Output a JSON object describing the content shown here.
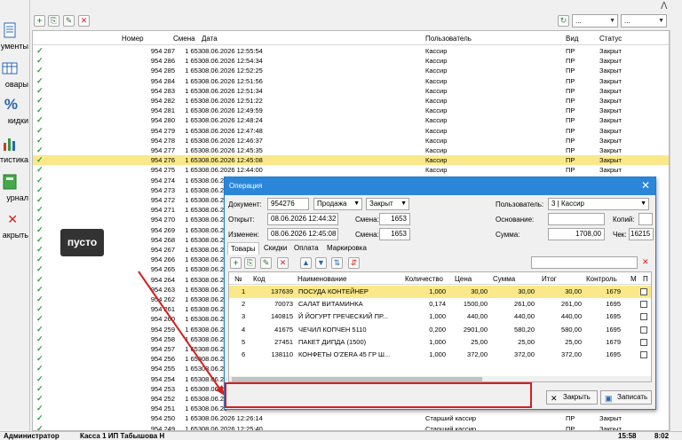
{
  "sidebar": {
    "items": [
      {
        "label": "ументы",
        "icon": "document-icon"
      },
      {
        "label": "овары",
        "icon": "goods-icon"
      },
      {
        "label": "кидки",
        "icon": "percent-icon"
      },
      {
        "label": "тистика",
        "icon": "statistics-icon"
      },
      {
        "label": "урнал",
        "icon": "journal-icon"
      },
      {
        "label": "акрыть",
        "icon": "close-icon"
      }
    ]
  },
  "toolbar": {
    "add": "+",
    "copy": "⎘",
    "edit": "✎",
    "delete": "✕",
    "refresh": "↻",
    "filter1": "...",
    "filter2": "...",
    "logo_fragment": "ᐱ"
  },
  "grid": {
    "headers": {
      "number": "Номер",
      "shift": "Смена",
      "date": "Дата",
      "user": "Пользователь",
      "type": "Вид",
      "status": "Статус"
    },
    "rows": [
      {
        "number": "954 287",
        "shift": "1 653",
        "date": "08.06.2026 12:55:54",
        "user": "Кассир",
        "type": "ПР",
        "status": "Закрыт"
      },
      {
        "number": "954 286",
        "shift": "1 653",
        "date": "08.06.2026 12:54:34",
        "user": "Кассир",
        "type": "ПР",
        "status": "Закрыт"
      },
      {
        "number": "954 285",
        "shift": "1 653",
        "date": "08.06.2026 12:52:25",
        "user": "Кассир",
        "type": "ПР",
        "status": "Закрыт"
      },
      {
        "number": "954 284",
        "shift": "1 653",
        "date": "08.06.2026 12:51:56",
        "user": "Кассир",
        "type": "ПР",
        "status": "Закрыт"
      },
      {
        "number": "954 283",
        "shift": "1 653",
        "date": "08.06.2026 12:51:34",
        "user": "Кассир",
        "type": "ПР",
        "status": "Закрыт"
      },
      {
        "number": "954 282",
        "shift": "1 653",
        "date": "08.06.2026 12:51:22",
        "user": "Кассир",
        "type": "ПР",
        "status": "Закрыт"
      },
      {
        "number": "954 281",
        "shift": "1 653",
        "date": "08.06.2026 12:49:59",
        "user": "Кассир",
        "type": "ПР",
        "status": "Закрыт"
      },
      {
        "number": "954 280",
        "shift": "1 653",
        "date": "08.06.2026 12:48:24",
        "user": "Кассир",
        "type": "ПР",
        "status": "Закрыт"
      },
      {
        "number": "954 279",
        "shift": "1 653",
        "date": "08.06.2026 12:47:48",
        "user": "Кассир",
        "type": "ПР",
        "status": "Закрыт"
      },
      {
        "number": "954 278",
        "shift": "1 653",
        "date": "08.06.2026 12:46:37",
        "user": "Кассир",
        "type": "ПР",
        "status": "Закрыт"
      },
      {
        "number": "954 277",
        "shift": "1 653",
        "date": "08.06.2026 12:45:35",
        "user": "Кассир",
        "type": "ПР",
        "status": "Закрыт"
      },
      {
        "number": "954 276",
        "shift": "1 653",
        "date": "08.06.2026 12:45:08",
        "user": "Кассир",
        "type": "ПР",
        "status": "Закрыт",
        "selected": true
      },
      {
        "number": "954 275",
        "shift": "1 653",
        "date": "08.06.2026 12:44:00",
        "user": "Кассир",
        "type": "ПР",
        "status": "Закрыт"
      },
      {
        "number": "954 274",
        "shift": "1 653",
        "date": "08.06.20",
        "user": "",
        "type": "",
        "status": ""
      },
      {
        "number": "954 273",
        "shift": "1 653",
        "date": "08.06.20",
        "user": "",
        "type": "",
        "status": ""
      },
      {
        "number": "954 272",
        "shift": "1 653",
        "date": "08.06.20",
        "user": "",
        "type": "",
        "status": ""
      },
      {
        "number": "954 271",
        "shift": "1 653",
        "date": "08.06.20",
        "user": "",
        "type": "",
        "status": ""
      },
      {
        "number": "954 270",
        "shift": "1 653",
        "date": "08.06.20",
        "user": "",
        "type": "",
        "status": ""
      },
      {
        "number": "954 269",
        "shift": "1 653",
        "date": "08.06.20",
        "user": "",
        "type": "",
        "status": ""
      },
      {
        "number": "954 268",
        "shift": "1 653",
        "date": "08.06.20",
        "user": "",
        "type": "",
        "status": ""
      },
      {
        "number": "954 267",
        "shift": "1 653",
        "date": "08.06.20",
        "user": "",
        "type": "",
        "status": ""
      },
      {
        "number": "954 266",
        "shift": "1 653",
        "date": "08.06.20",
        "user": "",
        "type": "",
        "status": ""
      },
      {
        "number": "954 265",
        "shift": "1 653",
        "date": "08.06.20",
        "user": "",
        "type": "",
        "status": ""
      },
      {
        "number": "954 264",
        "shift": "1 653",
        "date": "08.06.20",
        "user": "",
        "type": "",
        "status": ""
      },
      {
        "number": "954 263",
        "shift": "1 653",
        "date": "08.06.20",
        "user": "",
        "type": "",
        "status": ""
      },
      {
        "number": "954 262",
        "shift": "1 653",
        "date": "08.06.20",
        "user": "",
        "type": "",
        "status": ""
      },
      {
        "number": "954 261",
        "shift": "1 653",
        "date": "08.06.20",
        "user": "",
        "type": "",
        "status": ""
      },
      {
        "number": "954 260",
        "shift": "1 653",
        "date": "08.06.20",
        "user": "",
        "type": "",
        "status": ""
      },
      {
        "number": "954 259",
        "shift": "1 653",
        "date": "08.06.20",
        "user": "",
        "type": "",
        "status": ""
      },
      {
        "number": "954 258",
        "shift": "1 653",
        "date": "08.06.20",
        "user": "",
        "type": "",
        "status": ""
      },
      {
        "number": "954 257",
        "shift": "1 653",
        "date": "08.06.20",
        "user": "",
        "type": "",
        "status": ""
      },
      {
        "number": "954 256",
        "shift": "1 653",
        "date": "08.06.20",
        "user": "",
        "type": "",
        "status": ""
      },
      {
        "number": "954 255",
        "shift": "1 653",
        "date": "08.06.20",
        "user": "",
        "type": "",
        "status": ""
      },
      {
        "number": "954 254",
        "shift": "1 653",
        "date": "08.06.20",
        "user": "",
        "type": "",
        "status": ""
      },
      {
        "number": "954 253",
        "shift": "1 653",
        "date": "08.06.20",
        "user": "",
        "type": "",
        "status": ""
      },
      {
        "number": "954 252",
        "shift": "1 653",
        "date": "08.06.20",
        "user": "",
        "type": "",
        "status": ""
      },
      {
        "number": "954 251",
        "shift": "1 653",
        "date": "08.06.20",
        "user": "",
        "type": "",
        "status": ""
      },
      {
        "number": "954 250",
        "shift": "1 653",
        "date": "08.06.2026 12:26:14",
        "user": "Старший кассир",
        "type": "ПР",
        "status": "Закрыт"
      },
      {
        "number": "954 249",
        "shift": "1 653",
        "date": "08.06.2026 12:25:40",
        "user": "Старший кассир",
        "type": "ПР",
        "status": "Закрыт"
      }
    ]
  },
  "tooltip": {
    "text": "пусто"
  },
  "dialog": {
    "title": "Операция",
    "close": "✕",
    "doc_label": "Документ:",
    "doc_value": "954276",
    "op_type": "Продажа",
    "op_status": "Закрыт",
    "user_label": "Пользователь:",
    "user_value": "3 | Кассир",
    "opened_label": "Открыт:",
    "opened_value": "08.06.2026 12:44:32",
    "shift_label": "Смена:",
    "shift_value": "1653",
    "basis_label": "Основание:",
    "basis_value": "",
    "copies_label": "Копий:",
    "copies_value": "",
    "changed_label": "Изменен:",
    "changed_value": "08.06.2026 12:45:08",
    "shift2_label": "Смена:",
    "shift2_value": "1653",
    "sum_label": "Сумма:",
    "sum_value": "1708,00",
    "check_label": "Чек:",
    "check_value": "16215",
    "tabs": [
      "Товары",
      "Скидки",
      "Оплата",
      "Маркировка"
    ],
    "items_headers": {
      "n": "№",
      "code": "Код",
      "name": "Наименование",
      "qty": "Количество",
      "price": "Цена",
      "sum": "Сумма",
      "total": "Итог",
      "control": "Контроль",
      "m": "М",
      "p": "П"
    },
    "items": [
      {
        "n": "1",
        "code": "137639",
        "name": "ПОСУДА КОНТЕЙНЕР",
        "qty": "1,000",
        "price": "30,00",
        "sum": "30,00",
        "total": "30,00",
        "control": "1679",
        "selected": true
      },
      {
        "n": "2",
        "code": "70073",
        "name": "САЛАТ ВИТАМИНКА",
        "qty": "0,174",
        "price": "1500,00",
        "sum": "261,00",
        "total": "261,00",
        "control": "1695"
      },
      {
        "n": "3",
        "code": "140815",
        "name": "Й ЙОГУРТ ГРЕЧЕСКИЙ ПР...",
        "qty": "1,000",
        "price": "440,00",
        "sum": "440,00",
        "total": "440,00",
        "control": "1695"
      },
      {
        "n": "4",
        "code": "41675",
        "name": "ЧЕЧИЛ КОПЧЕН 5110",
        "qty": "0,200",
        "price": "2901,00",
        "sum": "580,20",
        "total": "580,00",
        "control": "1695"
      },
      {
        "n": "5",
        "code": "27451",
        "name": "ПАКЕТ ДИПДА (1500)",
        "qty": "1,000",
        "price": "25,00",
        "sum": "25,00",
        "total": "25,00",
        "control": "1679"
      },
      {
        "n": "6",
        "code": "138110",
        "name": "КОНФЕТЫ O'ZERA 45 ГР Ш...",
        "qty": "1,000",
        "price": "372,00",
        "sum": "372,00",
        "total": "372,00",
        "control": "1695"
      }
    ],
    "close_button": "Закрыть",
    "save_button": "Записать"
  },
  "statusbar": {
    "user": "Администратор",
    "cashbox": "Касса 1 ИП Табышова Н",
    "time": "15:58",
    "extra": "8:02"
  },
  "colors": {
    "accent": "#2b86d9",
    "selected_row": "#fbe88a",
    "check": "#2ea043",
    "highlight_box": "#d42020"
  }
}
